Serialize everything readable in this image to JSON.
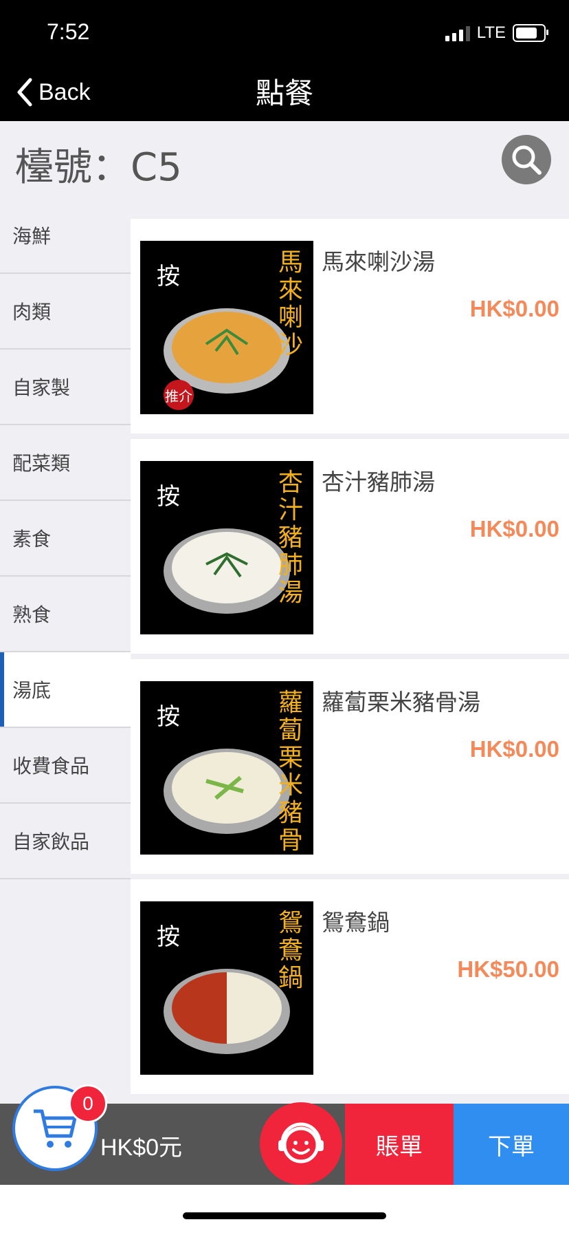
{
  "status": {
    "time": "7:52",
    "network": "LTE"
  },
  "nav": {
    "back_label": "Back",
    "title": "點餐"
  },
  "table": {
    "label": "檯號：C5"
  },
  "sidebar": {
    "items": [
      {
        "label": "海鮮",
        "active": false
      },
      {
        "label": "肉類",
        "active": false
      },
      {
        "label": "自家製",
        "active": false
      },
      {
        "label": "配菜類",
        "active": false
      },
      {
        "label": "素食",
        "active": false
      },
      {
        "label": "熟食",
        "active": false
      },
      {
        "label": "湯底",
        "active": true
      },
      {
        "label": "收費食品",
        "active": false
      },
      {
        "label": "自家飲品",
        "active": false
      }
    ]
  },
  "menu": {
    "items": [
      {
        "name": "馬來喇沙湯",
        "price": "HK$0.00",
        "thumb_press": "按",
        "thumb_title": "馬來喇沙",
        "thumb_badge": "推介"
      },
      {
        "name": "杏汁豬肺湯",
        "price": "HK$0.00",
        "thumb_press": "按",
        "thumb_title": "杏汁豬肺湯"
      },
      {
        "name": "蘿蔔栗米豬骨湯",
        "price": "HK$0.00",
        "thumb_press": "按",
        "thumb_title": "蘿蔔栗米豬骨湯"
      },
      {
        "name": "鴛鴦鍋",
        "price": "HK$50.00",
        "thumb_press": "按",
        "thumb_title": "鴛鴦鍋"
      }
    ]
  },
  "cart": {
    "count": "0",
    "total": "HK$0元"
  },
  "actions": {
    "bill_label": "賬單",
    "order_label": "下單"
  },
  "colors": {
    "accent_blue": "#2f8ef0",
    "accent_red": "#f0243a",
    "price_orange": "#f4895a",
    "active_indicator": "#1e5fb8"
  }
}
